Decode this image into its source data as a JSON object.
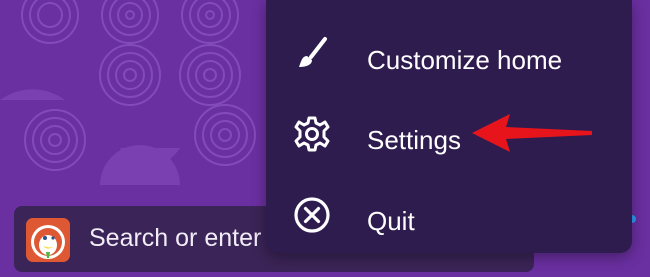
{
  "menu": {
    "items": [
      {
        "icon": "paintbrush-icon",
        "label": "Customize home"
      },
      {
        "icon": "gear-icon",
        "label": "Settings"
      },
      {
        "icon": "close-circle-icon",
        "label": "Quit"
      }
    ]
  },
  "search": {
    "placeholder": "Search or enter ."
  },
  "colors": {
    "background": "#6a2fa0",
    "menu_bg": "#2e1c4f",
    "annotation_arrow": "#e8141b",
    "search_bar_bg": "#3b2457"
  }
}
